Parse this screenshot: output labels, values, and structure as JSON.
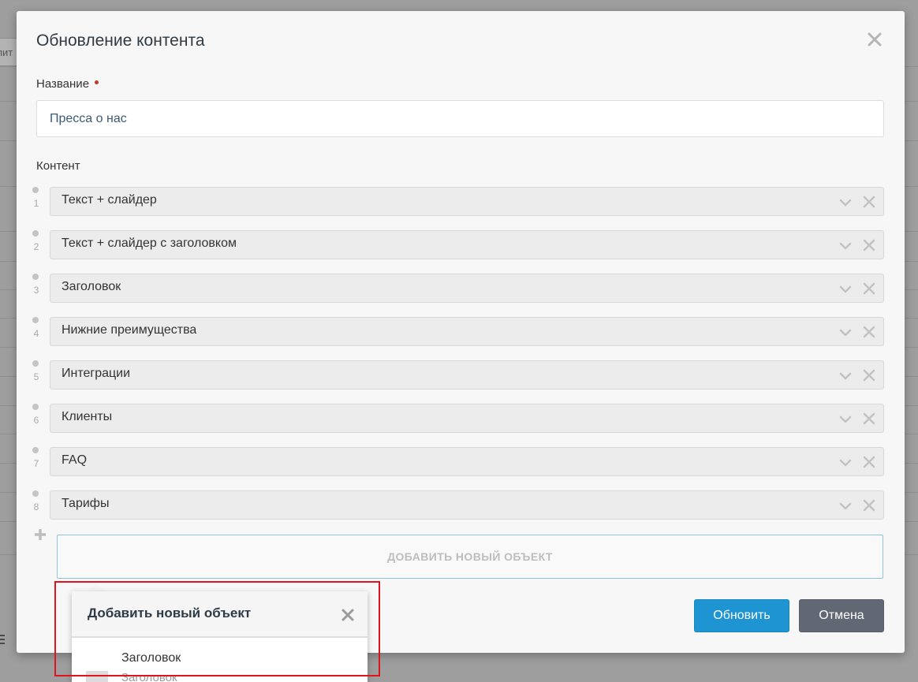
{
  "background": {
    "tab_label": "пит"
  },
  "modal": {
    "title": "Обновление контента",
    "name_label": "Название",
    "name_value": "Пресса о нас",
    "content_label": "Контент",
    "items": [
      {
        "num": "1",
        "label": "Текст + слайдер"
      },
      {
        "num": "2",
        "label": "Текст + слайдер с заголовком"
      },
      {
        "num": "3",
        "label": "Заголовок"
      },
      {
        "num": "4",
        "label": "Нижние преимущества"
      },
      {
        "num": "5",
        "label": "Интеграции"
      },
      {
        "num": "6",
        "label": "Клиенты"
      },
      {
        "num": "7",
        "label": "FAQ"
      },
      {
        "num": "8",
        "label": "Тарифы"
      }
    ],
    "add_object_label": "Добавить новый объект",
    "update_label": "Обновить",
    "cancel_label": "Отмена"
  },
  "popover": {
    "title": "Добавить новый объект",
    "item_title": "Заголовок",
    "item_subtitle": "Заголовок"
  },
  "colors": {
    "primary": "#1f94d2",
    "secondary": "#616874",
    "required": "#c0392b",
    "highlight": "#e0141e"
  }
}
